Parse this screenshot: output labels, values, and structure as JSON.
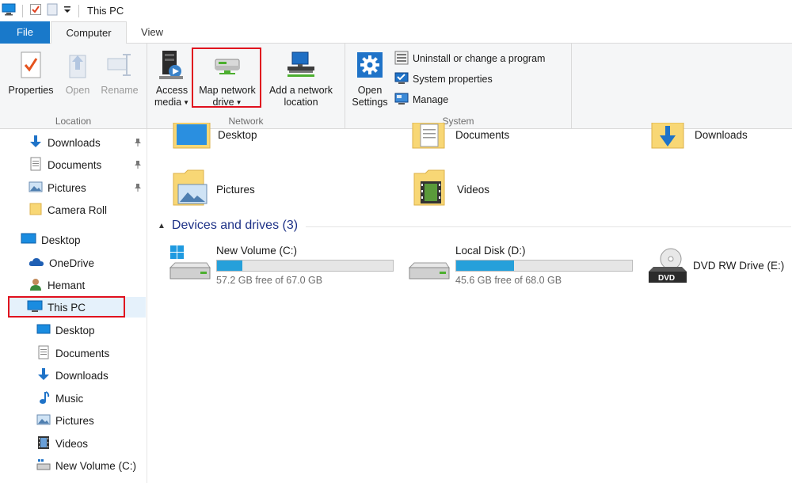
{
  "window": {
    "title": "This PC"
  },
  "tabs": [
    {
      "label": "File"
    },
    {
      "label": "Computer"
    },
    {
      "label": "View"
    }
  ],
  "ribbon": {
    "location": {
      "label": "Location",
      "properties": "Properties",
      "open": "Open",
      "rename": "Rename"
    },
    "network": {
      "label": "Network",
      "access_media_1": "Access",
      "access_media_2": "media",
      "map_drive_1": "Map network",
      "map_drive_2": "drive",
      "add_location_1": "Add a network",
      "add_location_2": "location"
    },
    "system": {
      "label": "System",
      "open_settings_1": "Open",
      "open_settings_2": "Settings",
      "uninstall": "Uninstall or change a program",
      "system_properties": "System properties",
      "manage": "Manage"
    }
  },
  "nav": {
    "quick_access": [
      {
        "label": "Downloads"
      },
      {
        "label": "Documents"
      },
      {
        "label": "Pictures"
      },
      {
        "label": "Camera Roll"
      }
    ],
    "desktop": "Desktop",
    "onedrive": "OneDrive",
    "user": "Hemant",
    "this_pc": "This PC",
    "this_pc_children": [
      {
        "label": "Desktop"
      },
      {
        "label": "Documents"
      },
      {
        "label": "Downloads"
      },
      {
        "label": "Music"
      },
      {
        "label": "Pictures"
      },
      {
        "label": "Videos"
      },
      {
        "label": "New Volume (C:)"
      }
    ]
  },
  "folders": [
    {
      "label": "Desktop"
    },
    {
      "label": "Documents"
    },
    {
      "label": "Downloads"
    },
    {
      "label": "Pictures"
    },
    {
      "label": "Videos"
    }
  ],
  "devices": {
    "header": "Devices and drives (3)",
    "drives": [
      {
        "name": "New Volume (C:)",
        "free": "57.2 GB free of 67.0 GB",
        "used_fraction": 0.146
      },
      {
        "name": "Local Disk (D:)",
        "free": "45.6 GB free of 68.0 GB",
        "used_fraction": 0.329
      },
      {
        "name": "DVD RW Drive (E:)"
      }
    ]
  },
  "colors": {
    "accent": "#1979ca",
    "drive_fill": "#26a0da",
    "highlight": "#e0101e",
    "section_title": "#1e3287"
  }
}
